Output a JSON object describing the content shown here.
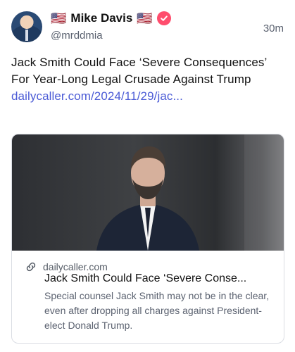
{
  "author": {
    "display_name": "Mike Davis",
    "flag_left": "🇺🇸",
    "flag_right": "🇺🇸",
    "handle": "@mrddmia",
    "verified_color": "#ff4d6d"
  },
  "post": {
    "time": "30m",
    "text": "Jack Smith Could Face ‘Severe Consequences’ For Year-Long Legal Crusade Against Trump ",
    "link_text": "dailycaller.com/2024/11/29/jac..."
  },
  "card": {
    "domain": "dailycaller.com",
    "title": "Jack Smith Could Face ‘Severe Conse...",
    "description": "Special counsel Jack Smith may not be in the clear, even after dropping all charges against President-elect Donald Trump.",
    "link_icon": "link-icon"
  },
  "colors": {
    "link": "#4b5bd6",
    "muted": "#5b6270",
    "border": "#dadde3"
  }
}
